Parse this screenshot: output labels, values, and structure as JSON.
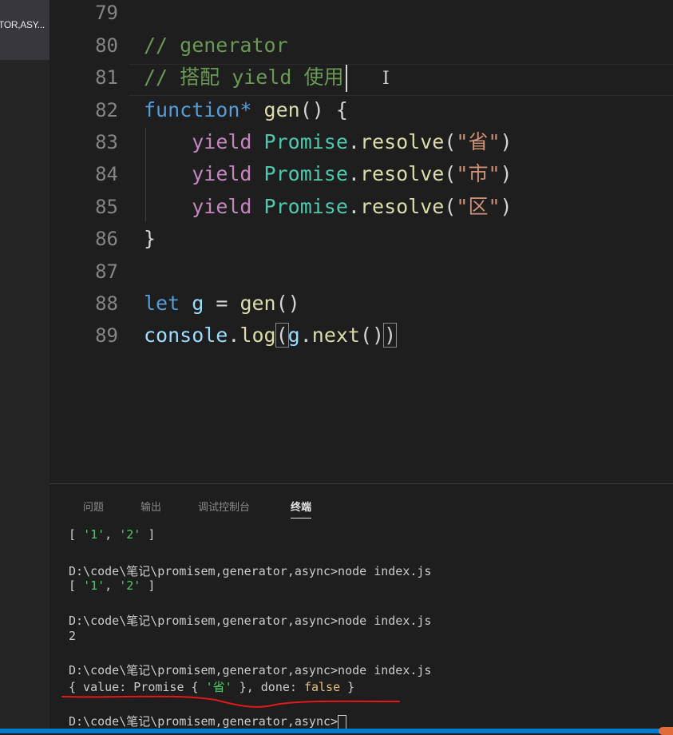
{
  "sidebar": {
    "tab_label": "TOR,ASY..."
  },
  "editor": {
    "lines": [
      {
        "num": "79"
      },
      {
        "num": "80",
        "comment": "// generator"
      },
      {
        "num": "81",
        "comment": "// 搭配 yield 使用"
      },
      {
        "num": "82",
        "kw": "function*",
        "fn": "gen",
        "rest": "() {"
      },
      {
        "num": "83",
        "yield": "yield",
        "cls": "Promise",
        "dot": ".",
        "fn": "resolve",
        "open": "(",
        "str": "\"省\"",
        "close": ")"
      },
      {
        "num": "84",
        "yield": "yield",
        "cls": "Promise",
        "dot": ".",
        "fn": "resolve",
        "open": "(",
        "str": "\"市\"",
        "close": ")"
      },
      {
        "num": "85",
        "yield": "yield",
        "cls": "Promise",
        "dot": ".",
        "fn": "resolve",
        "open": "(",
        "str": "\"区\"",
        "close": ")"
      },
      {
        "num": "86",
        "text": "}"
      },
      {
        "num": "87"
      },
      {
        "num": "88",
        "kw": "let",
        "var": "g",
        "eq": " = ",
        "fn": "gen",
        "rest": "()"
      },
      {
        "num": "89",
        "var1": "console",
        "dot": ".",
        "fn": "log",
        "open": "(",
        "var2": "g",
        "dot2": ".",
        "fn2": "next",
        "args": "()",
        "close": ")"
      }
    ],
    "mouse_cursor_glyph": "I"
  },
  "panel": {
    "tabs": [
      {
        "label": "问题",
        "active": false
      },
      {
        "label": "输出",
        "active": false
      },
      {
        "label": "调试控制台",
        "active": false
      },
      {
        "label": "终端",
        "active": true
      }
    ],
    "terminal": {
      "l1_open": "[ ",
      "l1_s1": "'1'",
      "l1_mid": ", ",
      "l1_s2": "'2'",
      "l1_close": " ]",
      "prompt1": "D:\\code\\笔记\\promisem,generator,async>node index.js",
      "l3_open": "[ ",
      "l3_s1": "'1'",
      "l3_mid": ", ",
      "l3_s2": "'2'",
      "l3_close": " ]",
      "prompt2": "D:\\code\\笔记\\promisem,generator,async>node index.js",
      "out2": "2",
      "prompt3": "D:\\code\\笔记\\promisem,generator,async>node index.js",
      "out3_a": "{ value: Promise { ",
      "out3_str": "'省'",
      "out3_b": " }, done: ",
      "out3_bool": "false",
      "out3_c": " }",
      "prompt4": "D:\\code\\笔记\\promisem,generator,async>"
    }
  },
  "colors": {
    "annotation_underline": "#e0191b",
    "status_bar": "#007acc"
  }
}
